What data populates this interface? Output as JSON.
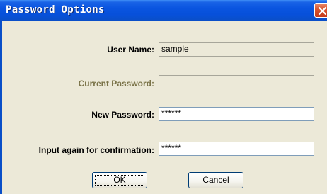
{
  "dialog": {
    "title": "Password Options",
    "close_icon": "close-x-icon",
    "accent": "#0a55e0",
    "close_color": "#d8532e"
  },
  "fields": [
    {
      "label": "User Name:",
      "value": "sample",
      "state": "readonly"
    },
    {
      "label": "Current Password:",
      "value": "",
      "state": "disabled"
    },
    {
      "label": "New Password:",
      "value": "******",
      "state": "enabled"
    },
    {
      "label": "Input again for confirmation:",
      "value": "******",
      "state": "enabled"
    }
  ],
  "buttons": {
    "ok": "OK",
    "cancel": "Cancel"
  }
}
